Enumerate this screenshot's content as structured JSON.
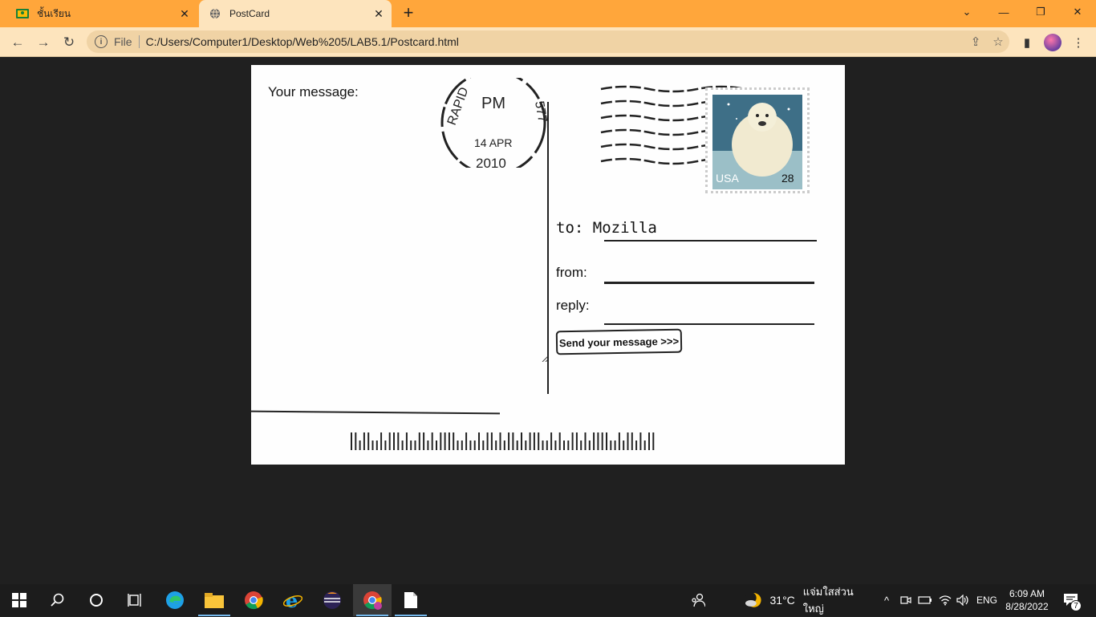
{
  "browser": {
    "tabs": [
      {
        "title": "ชั้นเรียน",
        "icon": "classroom-icon",
        "active": false
      },
      {
        "title": "PostCard",
        "icon": "globe-icon",
        "active": true
      }
    ],
    "new_tab": "+",
    "address": {
      "security_label": "File",
      "url": "C:/Users/Computer1/Desktop/Web%205/LAB5.1/Postcard.html"
    }
  },
  "postcard": {
    "message_label": "Your message:",
    "to_label": "to: Mozilla",
    "from_label": "from:",
    "reply_label": "reply:",
    "send_button": "Send your message >>>",
    "postmark": {
      "city": "RAPID",
      "time": "PM",
      "date": "14 APR",
      "year": "2010",
      "code": "577"
    },
    "stamp": {
      "country": "USA",
      "value": "28"
    }
  },
  "taskbar": {
    "weather": {
      "temp": "31°C",
      "desc": "แจ่มใสส่วนใหญ่"
    },
    "language": "ENG",
    "time": "6:09 AM",
    "date": "8/28/2022",
    "notifications": "7"
  },
  "colors": {
    "titlebar": "#ffa63b",
    "toolbar": "#fde4bd",
    "page_background": "#202020",
    "taskbar": "#1c1c1c"
  }
}
